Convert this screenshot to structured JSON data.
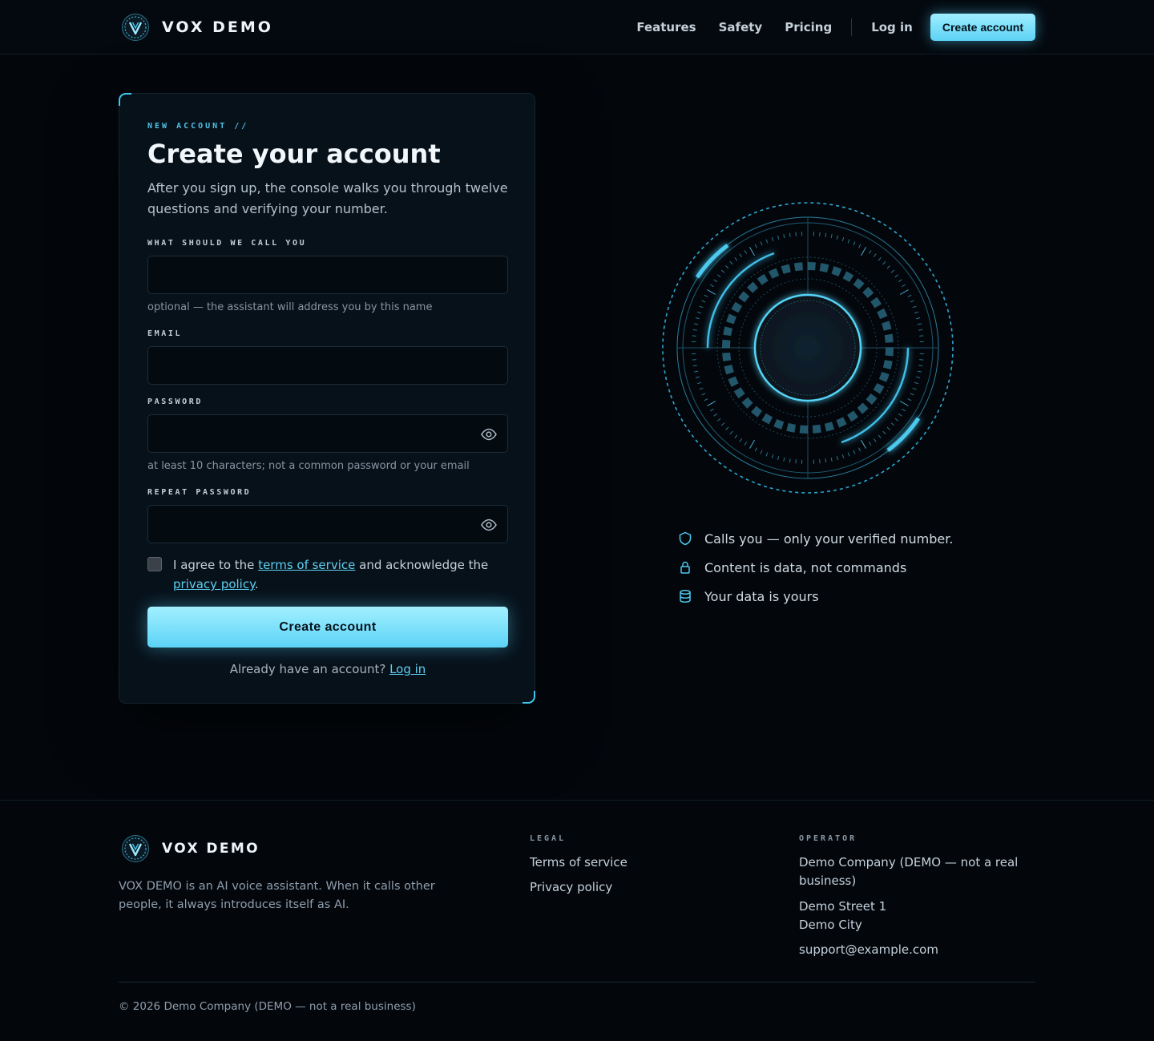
{
  "colors": {
    "background": "#03070c",
    "card": "#07111a",
    "accent": "#5fd0f2",
    "button": "#7fe2fa"
  },
  "header": {
    "brand": "VOX DEMO",
    "logo_icon": "shield-v-logo-icon",
    "nav": [
      "Features",
      "Safety",
      "Pricing"
    ],
    "login": "Log in",
    "create_account": "Create account"
  },
  "form": {
    "eyebrow": "NEW ACCOUNT //",
    "title": "Create your account",
    "subtitle": "After you sign up, the console walks you through twelve questions and verifying your number.",
    "name": {
      "label": "WHAT SHOULD WE CALL YOU",
      "value": "",
      "hint": "optional — the assistant will address you by this name"
    },
    "email": {
      "label": "EMAIL",
      "value": ""
    },
    "password": {
      "label": "PASSWORD",
      "value": "",
      "hint": "at least 10 characters; not a common password or your email",
      "toggle_icon": "eye-icon"
    },
    "repeat_password": {
      "label": "REPEAT PASSWORD",
      "value": "",
      "toggle_icon": "eye-icon"
    },
    "agree": {
      "checked": false,
      "prefix": "I agree to the ",
      "terms_link": "terms of service",
      "middle": " and acknowledge the ",
      "privacy_link": "privacy policy",
      "suffix": "."
    },
    "submit": "Create account",
    "already_prefix": "Already have an account? ",
    "login_link": "Log in"
  },
  "features": [
    {
      "icon": "shield-icon",
      "text": "Calls you — only your verified number."
    },
    {
      "icon": "lock-icon",
      "text": "Content is data, not commands"
    },
    {
      "icon": "database-icon",
      "text": "Your data is yours"
    }
  ],
  "footer": {
    "brand": "VOX DEMO",
    "description": "VOX DEMO is an AI voice assistant. When it calls other people, it always introduces itself as AI.",
    "legal_title": "LEGAL",
    "legal_links": [
      "Terms of service",
      "Privacy policy"
    ],
    "operator_title": "OPERATOR",
    "operator_name": "Demo Company (DEMO — not a real business)",
    "street": "Demo Street 1",
    "city": "Demo City",
    "email": "support@example.com",
    "copyright": "© 2026 Demo Company (DEMO — not a real business)"
  }
}
